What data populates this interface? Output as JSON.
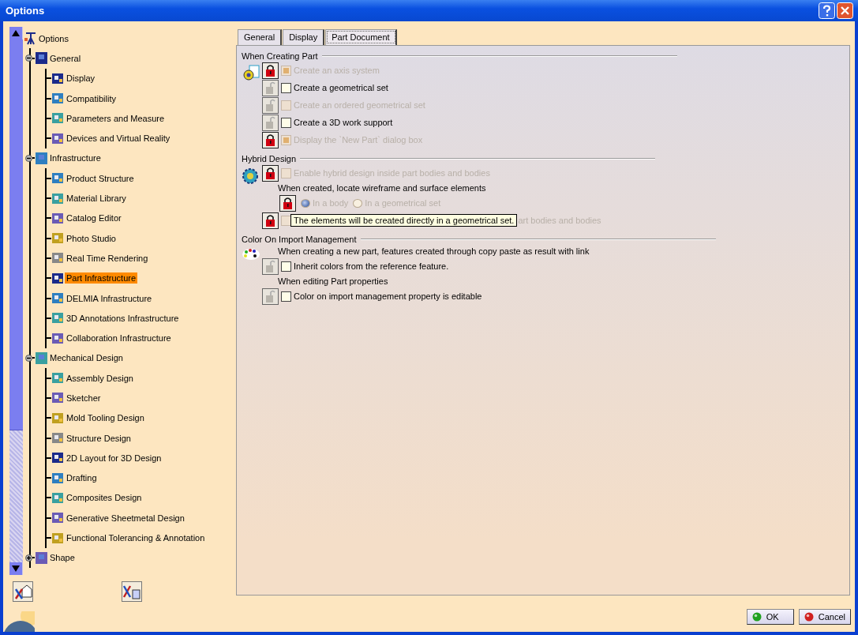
{
  "window": {
    "title": "Options"
  },
  "tree": {
    "label": "Options",
    "expanded": true,
    "selected": false,
    "children": [
      {
        "label": "General",
        "expanded": true,
        "selected": false,
        "children": [
          {
            "label": "Display",
            "selected": false
          },
          {
            "label": "Compatibility",
            "selected": false
          },
          {
            "label": "Parameters and Measure",
            "selected": false
          },
          {
            "label": "Devices and Virtual Reality",
            "selected": false
          }
        ]
      },
      {
        "label": "Infrastructure",
        "expanded": true,
        "selected": false,
        "children": [
          {
            "label": "Product Structure",
            "selected": false
          },
          {
            "label": "Material Library",
            "selected": false
          },
          {
            "label": "Catalog Editor",
            "selected": false
          },
          {
            "label": "Photo Studio",
            "selected": false
          },
          {
            "label": "Real Time Rendering",
            "selected": false
          },
          {
            "label": "Part Infrastructure",
            "selected": true
          },
          {
            "label": "DELMIA Infrastructure",
            "selected": false
          },
          {
            "label": "3D Annotations Infrastructure",
            "selected": false
          },
          {
            "label": "Collaboration Infrastructure",
            "selected": false
          }
        ]
      },
      {
        "label": "Mechanical Design",
        "expanded": true,
        "selected": false,
        "children": [
          {
            "label": "Assembly Design",
            "selected": false
          },
          {
            "label": "Sketcher",
            "selected": false
          },
          {
            "label": "Mold Tooling Design",
            "selected": false
          },
          {
            "label": "Structure Design",
            "selected": false
          },
          {
            "label": "2D Layout for 3D Design",
            "selected": false
          },
          {
            "label": "Drafting",
            "selected": false
          },
          {
            "label": "Composites Design",
            "selected": false
          },
          {
            "label": "Generative Sheetmetal Design",
            "selected": false
          },
          {
            "label": "Functional Tolerancing & Annotation",
            "selected": false
          }
        ]
      },
      {
        "label": "Shape",
        "expanded": false,
        "selected": false
      }
    ]
  },
  "tabs": [
    {
      "label": "General",
      "selected": false
    },
    {
      "label": "Display",
      "selected": false
    },
    {
      "label": "Part Document",
      "selected": true
    }
  ],
  "sections": [
    {
      "title": "When Creating Part",
      "rows": [
        {
          "kind": "checkbox",
          "locked": true,
          "label": "Create an axis system",
          "checked": true,
          "disabled": true
        },
        {
          "kind": "checkbox",
          "locked": false,
          "label": "Create a geometrical set",
          "checked": false,
          "disabled": false
        },
        {
          "kind": "checkbox",
          "locked": false,
          "label": "Create an ordered geometrical set",
          "checked": false,
          "disabled": true
        },
        {
          "kind": "checkbox",
          "locked": false,
          "label": "Create a 3D work support",
          "checked": false,
          "disabled": false
        },
        {
          "kind": "checkbox",
          "locked": true,
          "label": "Display the `New Part` dialog box",
          "checked": true,
          "disabled": true
        }
      ]
    },
    {
      "title": "Hybrid Design",
      "rows": [
        {
          "kind": "checkbox",
          "locked": true,
          "label": "Enable hybrid design inside part bodies and bodies",
          "checked": false,
          "disabled": true
        },
        {
          "kind": "label",
          "label": "When created, locate wireframe and surface elements"
        },
        {
          "kind": "radio",
          "locked": true,
          "options": [
            {
              "label": "In a body",
              "selected": true,
              "disabled": true
            },
            {
              "label": "In a geometrical set",
              "selected": false,
              "disabled": true
            }
          ]
        },
        {
          "kind": "checkbox",
          "locked": true,
          "label": "art bodies and bodies",
          "checked": false,
          "disabled": true,
          "tooltip": "The elements will be created directly in a geometrical set."
        }
      ]
    },
    {
      "title": "Color On Import Management",
      "rows": [
        {
          "kind": "label",
          "label": "When creating a new part, features created through copy paste as result with link"
        },
        {
          "kind": "checkbox",
          "locked": false,
          "label": "Inherit colors from the reference feature.",
          "checked": false,
          "disabled": false
        },
        {
          "kind": "label",
          "label": "When editing Part properties"
        },
        {
          "kind": "checkbox",
          "locked": false,
          "label": "Color on import management property is editable",
          "checked": false,
          "disabled": false
        }
      ]
    }
  ],
  "buttons": [
    {
      "label": "OK",
      "kind": "ok"
    },
    {
      "label": "Cancel",
      "kind": "cancel"
    }
  ]
}
